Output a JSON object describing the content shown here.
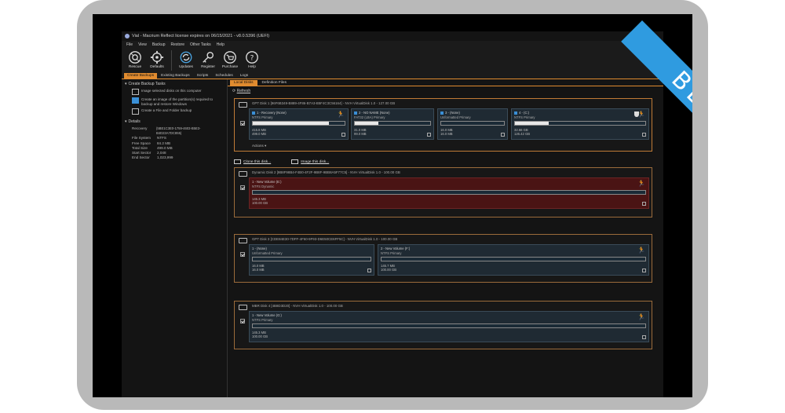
{
  "window": {
    "title": "Vial - Macrium Reflect license expires on 06/15/2021 - v8.0.5396 (UEFI)"
  },
  "menu": [
    "File",
    "View",
    "Backup",
    "Restore",
    "Other Tasks",
    "Help"
  ],
  "toolbar": [
    {
      "label": "Rescue",
      "icon": "rescue-icon"
    },
    {
      "label": "Defaults",
      "icon": "defaults-icon"
    },
    {
      "label": "Updates",
      "icon": "updates-icon"
    },
    {
      "label": "Register",
      "icon": "key-icon"
    },
    {
      "label": "Purchase",
      "icon": "cart-icon"
    },
    {
      "label": "Help",
      "icon": "help-icon"
    }
  ],
  "main_tabs": [
    "Create Backups",
    "Existing Backups",
    "Scripts",
    "Schedules",
    "Logs"
  ],
  "left": {
    "tasks_header": "Create Backup Tasks",
    "tasks": [
      "Image selected disks on this computer",
      "Create an image of the partition(s) required to backup and restore Windows",
      "Create a File and Folder backup"
    ],
    "details_header": "Details",
    "details": [
      {
        "k": "Recovery",
        "v": "{5BE1C3E0-1759-4603-B5E3-B4D23A7DC855}"
      },
      {
        "k": "File System",
        "v": "NTFS"
      },
      {
        "k": "Free Space",
        "v": "84.2 MB"
      },
      {
        "k": "Total Size",
        "v": "499.0 MB"
      },
      {
        "k": "Start Sector",
        "v": "2,048"
      },
      {
        "k": "End Sector",
        "v": "1,023,999"
      }
    ]
  },
  "sub_tabs": [
    "Local Disks",
    "Definition Files"
  ],
  "refresh_label": "Refresh",
  "disk1": {
    "header": "GPT Disk 1 [96F6B349-B889-4F86-B7A3-B5F4C3C56164] - NVH   VirtualDisk   1.0 - 127.00 GB",
    "parts": [
      {
        "title": "1 - Recovery (None)",
        "fs": "NTFS Primary",
        "used": "415.8 MB",
        "total": "499.0 MB",
        "fill": 0.83
      },
      {
        "title": "2 - NO NAME (None)",
        "fs": "FAT32 (LBA) Primary",
        "used": "31.0 MB",
        "total": "99.0 MB",
        "fill": 0.31
      },
      {
        "title": "3 - (None)",
        "fs": "Unformatted Primary",
        "used": "16.0 MB",
        "total": "16.0 MB",
        "fill": 0.0
      },
      {
        "title": "4 - (C:)",
        "fs": "NTFS Primary",
        "used": "32.66 GB",
        "total": "126.42 GB",
        "fill": 0.26
      }
    ],
    "actions": "Actions"
  },
  "links": [
    "Clone this disk...",
    "Image this disk..."
  ],
  "disk2": {
    "header": "Dynamic Disk 2 [9B8F98B4-F4B0-4F2F-9B8F-9BB8A5F77C5] - NVH   VirtualDisk   1.0 - 100.00 GB",
    "part": {
      "title": "1 - New Volume (E:)",
      "fs": "NTFS Dynamic",
      "used": "145.3 MB",
      "total": "100.00 GB",
      "fill": 0.0
    }
  },
  "disk3": {
    "header": "GPT Disk 3 [CDE84E30-7DFF-4F60-9F93-D6E50CE6FF5C] - NVH   VirtualDisk   1.0 - 100.00 GB",
    "parts": [
      {
        "title": "1 - (None)",
        "fs": "Unformatted Primary",
        "used": "16.0 MB",
        "total": "16.0 MB",
        "fill": 0.0
      },
      {
        "title": "2 - New Volume (F:)",
        "fs": "NTFS Primary",
        "used": "145.7 MB",
        "total": "100.00 GB",
        "fill": 0.0
      }
    ]
  },
  "disk4": {
    "header": "MBR Disk 4 [4B8D3D20] - NVH   VirtualDisk   1.0 - 100.00 GB",
    "part": {
      "title": "1 - New Volume (G:)",
      "fs": "NTFS Primary",
      "used": "145.3 MB",
      "total": "100.00 GB",
      "fill": 0.0
    }
  },
  "badge": "BETA",
  "colors": {
    "accent": "#e08b2f",
    "beta": "#2f9be0",
    "dynamic": "#4a1414"
  }
}
